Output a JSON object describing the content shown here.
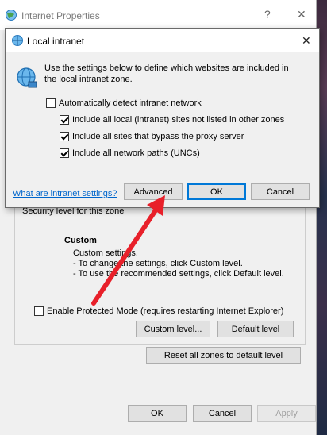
{
  "parent": {
    "title": "Internet Properties",
    "help_glyph": "?",
    "close_glyph": "✕",
    "security_level_label": "Security level for this zone",
    "custom_heading": "Custom",
    "custom_lines": [
      "Custom settings.",
      "- To change the settings, click Custom level.",
      "- To use the recommended settings, click Default level."
    ],
    "protected_mode_label": "Enable Protected Mode (requires restarting Internet Explorer)",
    "custom_level_btn": "Custom level...",
    "default_level_btn": "Default level",
    "reset_all_btn": "Reset all zones to default level",
    "ok_btn": "OK",
    "cancel_btn": "Cancel",
    "apply_btn": "Apply"
  },
  "dialog": {
    "title": "Local intranet",
    "close_glyph": "✕",
    "description": [
      "Use the settings below to define which websites are included in",
      "the local intranet zone."
    ],
    "options": [
      {
        "label": "Automatically detect intranet network",
        "checked": false
      },
      {
        "label": "Include all local (intranet) sites not listed in other zones",
        "checked": true
      },
      {
        "label": "Include all sites that bypass the proxy server",
        "checked": true
      },
      {
        "label": "Include all network paths (UNCs)",
        "checked": true
      }
    ],
    "help_link": "What are intranet settings?",
    "advanced_btn": "Advanced",
    "ok_btn": "OK",
    "cancel_btn": "Cancel"
  },
  "annotation": {
    "type": "red-arrow",
    "color": "#e8202a",
    "points_to": "Advanced"
  },
  "colors": {
    "accent": "#0078d7",
    "link": "#0066cc",
    "arrow": "#e8202a"
  }
}
